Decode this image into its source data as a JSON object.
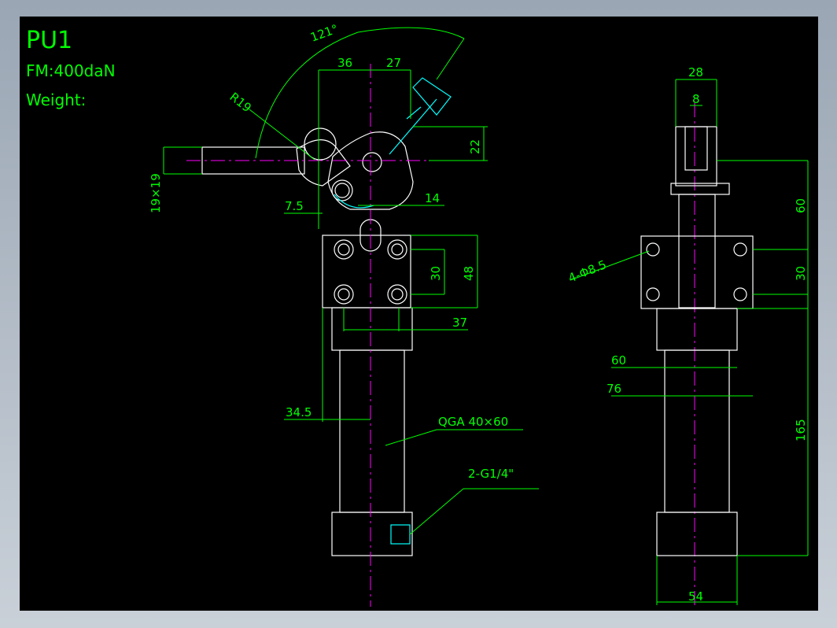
{
  "title": {
    "part": "PU1",
    "force": "FM:400daN",
    "weight": "Weight:"
  },
  "dims": {
    "angle": "121°",
    "r19": "R19",
    "d36": "36",
    "d27": "27",
    "d22": "22",
    "d19x19": "19×19",
    "d7_5": "7.5",
    "d14": "14",
    "d30_front": "30",
    "d48": "48",
    "d37": "37",
    "d34_5": "34.5",
    "cylinder": "QGA 40×60",
    "port": "2-G1/4\"",
    "d28": "28",
    "d8": "8",
    "d60_side": "60",
    "d30_side": "30",
    "holes": "4-Φ8.5",
    "d60_base": "60",
    "d76": "76",
    "d165": "165",
    "d54": "54"
  },
  "colors": {
    "background": "#000000",
    "geometry": "#ffffff",
    "dimension": "#00ff00",
    "centerline": "#ff00ff",
    "hidden": "#00ffff"
  }
}
